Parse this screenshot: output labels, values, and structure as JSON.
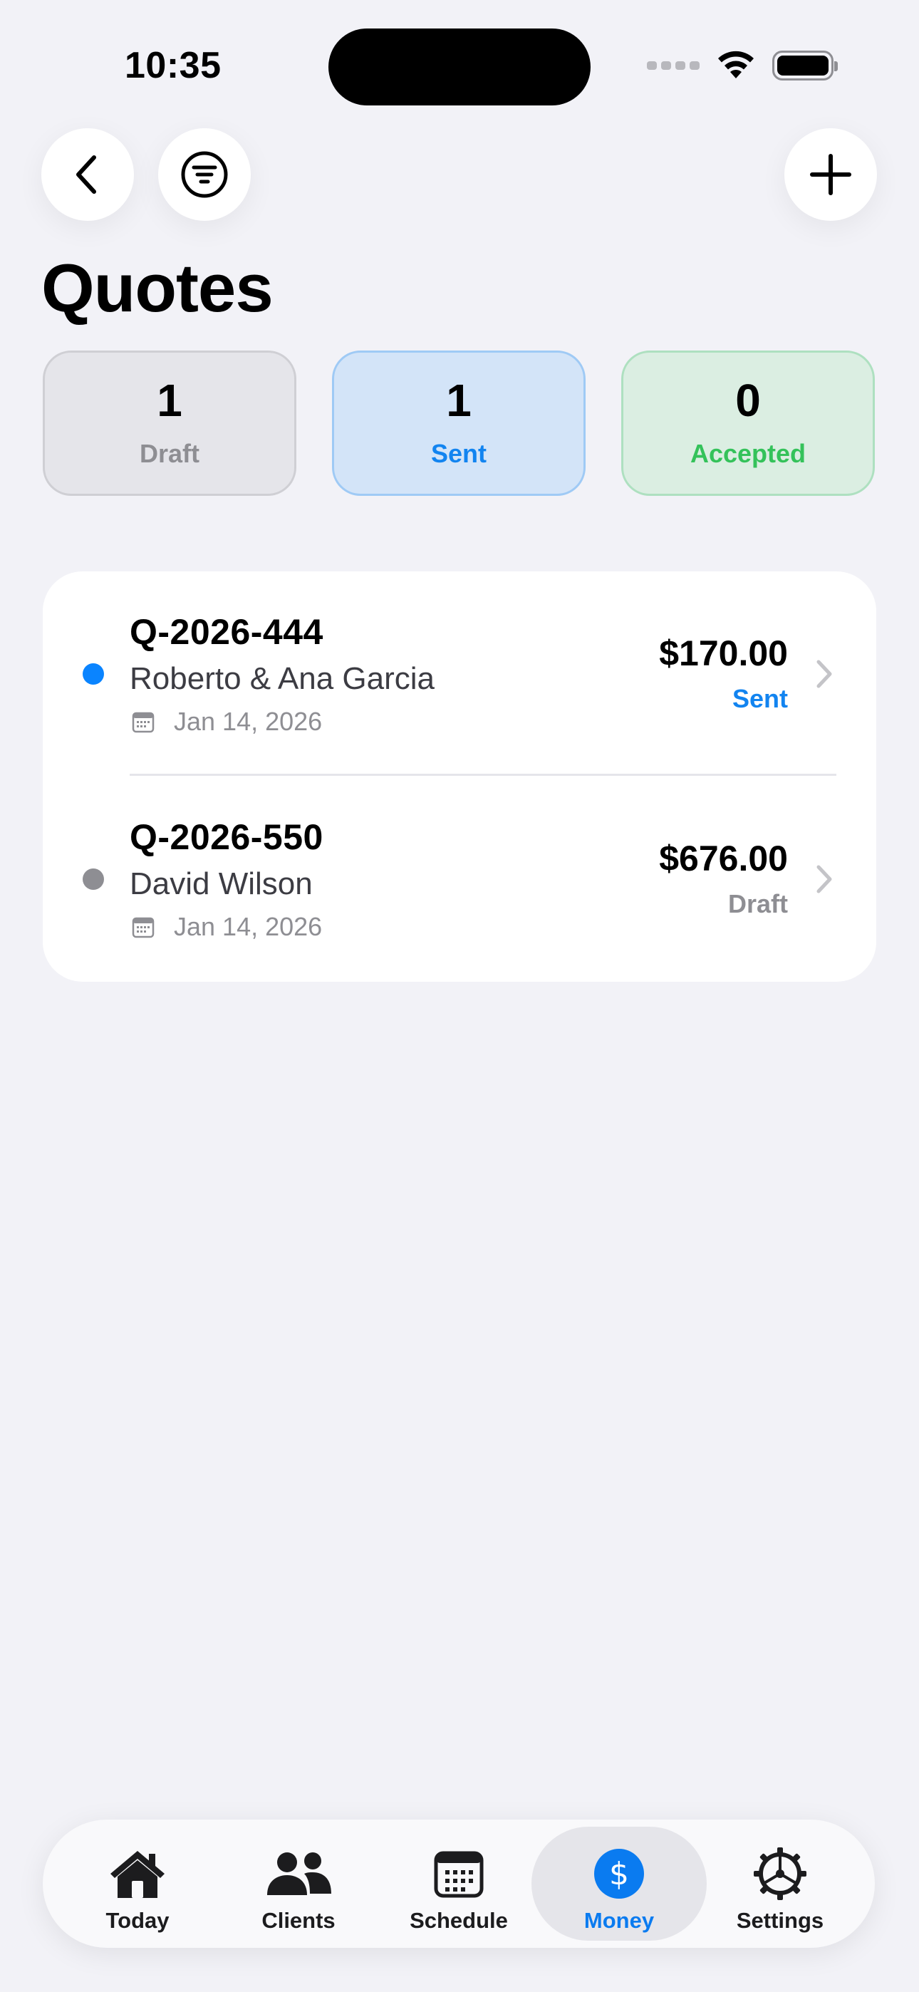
{
  "status_bar": {
    "time": "10:35"
  },
  "header": {
    "title": "Quotes"
  },
  "summary": [
    {
      "count": "1",
      "label": "Draft"
    },
    {
      "count": "1",
      "label": "Sent"
    },
    {
      "count": "0",
      "label": "Accepted"
    }
  ],
  "quotes": [
    {
      "number": "Q-2026-444",
      "client": "Roberto & Ana Garcia",
      "date": "Jan 14, 2026",
      "amount": "$170.00",
      "status": "Sent",
      "status_color": "#1284f0"
    },
    {
      "number": "Q-2026-550",
      "client": "David Wilson",
      "date": "Jan 14, 2026",
      "amount": "$676.00",
      "status": "Draft",
      "status_color": "#8e8e93"
    }
  ],
  "tab_bar": {
    "today": "Today",
    "clients": "Clients",
    "schedule": "Schedule",
    "money": "Money",
    "money_symbol": "$",
    "settings": "Settings",
    "active": "money",
    "accent_color": "#0a7bf0"
  },
  "icons": {
    "back": "chevron-left-icon",
    "filter": "filter-icon",
    "add": "plus-icon",
    "date": "calendar-icon",
    "row_chevron": "chevron-right-icon",
    "today": "house-icon",
    "clients": "people-icon",
    "schedule": "calendar-grid-icon",
    "money": "dollar-icon",
    "settings": "gear-icon"
  }
}
